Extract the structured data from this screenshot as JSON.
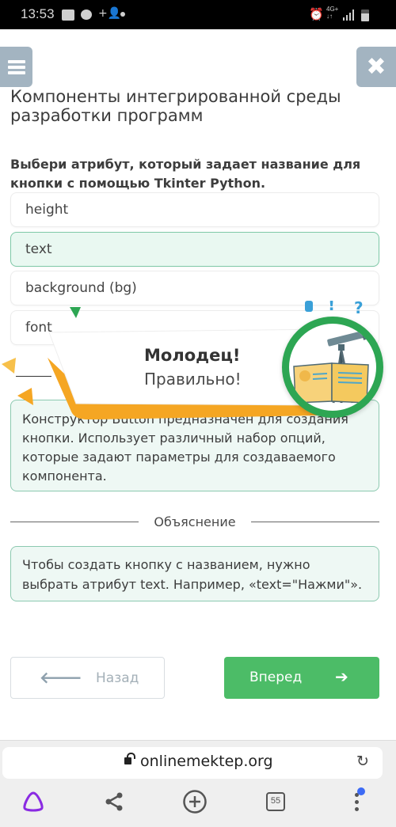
{
  "status_bar": {
    "time": "13:53",
    "left_icons": [
      "image-icon",
      "message-icon",
      "add-person-icon",
      "dot-icon"
    ],
    "right_icons": [
      "alarm-icon",
      "network-4g-icon",
      "signal-icon",
      "battery-icon"
    ],
    "network_label": "4G+",
    "network_arrows": "↓↑"
  },
  "header": {
    "menu_icon": "hamburger-icon",
    "close_icon": "close-icon",
    "close_glyph": "✖",
    "title": "Компоненты интегрированной среды разработки программ"
  },
  "question": {
    "text": "Выбери атрибут, который задает название для кнопки с помощью Tkinter Python.",
    "options": [
      {
        "label": "height",
        "state": "default"
      },
      {
        "label": "text",
        "state": "correct"
      },
      {
        "label": "background (bg)",
        "state": "default"
      },
      {
        "label": "font",
        "state": "default"
      }
    ]
  },
  "feedback": {
    "text": "Конструктор Button предназначен для создания кнопки. Использует различный набор опций, которые задают параметры для создаваемого компонента."
  },
  "explanation": {
    "heading": "Объяснение",
    "text": "Чтобы создать кнопку с названием, нужно выбрать атрибут text. Например, «text=\"Нажми\"»."
  },
  "navigation": {
    "back_label": "Назад",
    "back_arrow": "🡐",
    "next_label": "Вперед",
    "next_arrow": "➔"
  },
  "popup": {
    "title": "Молодец!",
    "subtitle": "Правильно!",
    "emblem": "telescope-book-icon",
    "decor_symbols": [
      "!",
      "?"
    ]
  },
  "browser": {
    "url": "onlinemektep.org",
    "lock_icon": "unlocked-lock-icon",
    "reload_glyph": "↻",
    "tab_count": "55",
    "nav_icons": [
      "alice-icon",
      "share-icon",
      "new-tab-icon",
      "tabs-icon",
      "more-icon"
    ]
  },
  "colors": {
    "accent_green": "#4cbc67",
    "correct_bg": "#e9f8f1",
    "correct_border": "#7fc9a8",
    "header_button": "#a3b4c1",
    "popup_orange": "#f5a623",
    "emblem_ring": "#2da653",
    "notify_dot": "#3d6bf5"
  }
}
